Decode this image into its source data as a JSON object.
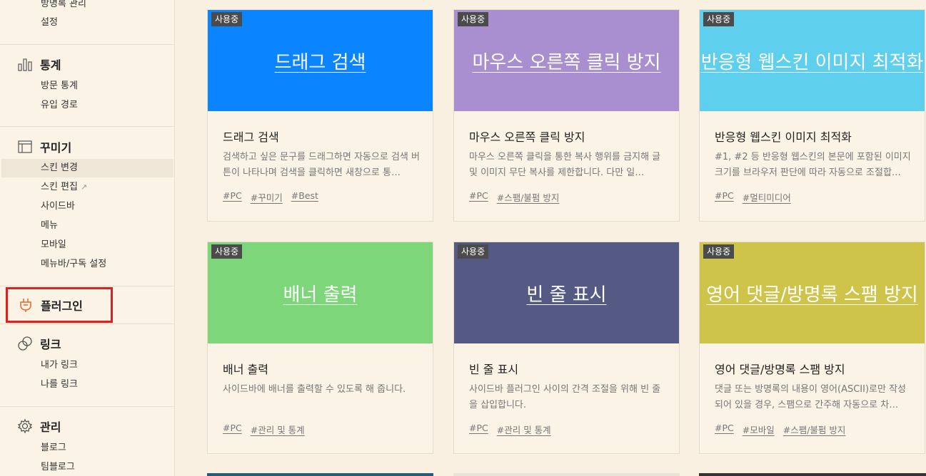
{
  "sidebar": {
    "top_items": [
      "방명록 관리",
      "설정"
    ],
    "stats": {
      "title": "통계",
      "items": [
        "방문 통계",
        "유입 경로"
      ]
    },
    "decorate": {
      "title": "꾸미기",
      "items": [
        "스킨 변경",
        "스킨 편집",
        "사이드바",
        "메뉴",
        "모바일",
        "메뉴바/구독 설정"
      ],
      "external_icon": "↗"
    },
    "plugin": {
      "title": "플러그인"
    },
    "link": {
      "title": "링크",
      "items": [
        "내가 링크",
        "나를 링크"
      ]
    },
    "manage": {
      "title": "관리",
      "items": [
        "블로그",
        "팀블로그"
      ]
    }
  },
  "cards": [
    {
      "badge": "사용중",
      "thumb_text": "드래그 검색",
      "title": "드래그 검색",
      "desc": "검색하고 싶은 문구를 드래그하면 자동으로 검색 버튼이 나타나며 검색을 클릭하면 새창으로 통…",
      "tags": [
        "#PC",
        "#꾸미기",
        "#Best"
      ],
      "color": "#0a84ff"
    },
    {
      "badge": "사용중",
      "thumb_text": "마우스 오른쪽 클릭 방지",
      "title": "마우스 오른쪽 클릭 방지",
      "desc": "마우스 오른쪽 클릭을 통한 복사 행위를 금지해 글 및 이미지 무단 복사를 제한합니다. 다만 일…",
      "tags": [
        "#PC",
        "#스팸/불펌 방지"
      ],
      "color": "#a98ed0"
    },
    {
      "badge": "사용중",
      "thumb_text": "반응형 웹스킨 이미지 최적화",
      "title": "반응형 웹스킨 이미지 최적화",
      "desc": "#1, #2 등 반응형 웹스킨의 본문에 포함된 이미지 크기를 브라우저 판단에 따라 자동으로 조절합…",
      "tags": [
        "#PC",
        "#멀티미디어"
      ],
      "color": "#5ed0ee"
    },
    {
      "badge": "사용중",
      "thumb_text": "배너 출력",
      "title": "배너 출력",
      "desc": "사이드바에 배너를 출력할 수 있도록 해 줍니다.",
      "tags": [
        "#PC",
        "#관리 및 통계"
      ],
      "color": "#7dd67a"
    },
    {
      "badge": "사용중",
      "thumb_text": "빈 줄 표시",
      "title": "빈 줄 표시",
      "desc": "사이드바 플러그인 사이의 간격 조절을 위해 빈 줄을 삽입합니다.",
      "tags": [
        "#PC",
        "#관리 및 통계"
      ],
      "color": "#555a85"
    },
    {
      "badge": "사용중",
      "thumb_text": "영어 댓글/방명록 스팸 방지",
      "title": "영어 댓글/방명록 스팸 방지",
      "desc": "댓글 또는 방명록의 내용이 영어(ASCII)로만 작성되어 있을 경우, 스팸으로 간주해 자동으로 차…",
      "tags": [
        "#PC",
        "#모바일",
        "#스팸/불펌 방지"
      ],
      "color": "#cfc44a"
    }
  ]
}
